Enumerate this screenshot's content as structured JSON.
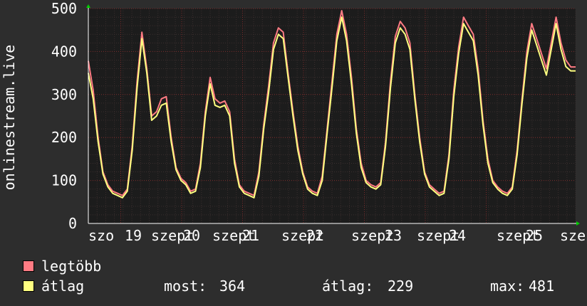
{
  "chart_data": {
    "type": "line",
    "ylabel": "onlinestream.live",
    "ylim": [
      0,
      500
    ],
    "y_ticks": [
      0,
      100,
      200,
      300,
      400,
      500
    ],
    "x_tick_labels": [
      "szo",
      "19",
      "szept",
      "20",
      "szept",
      "21",
      "szept",
      "22",
      "szept",
      "23",
      "szept",
      "24",
      "szept",
      "25",
      "szept"
    ],
    "grid": true,
    "colors": {
      "background": "#2d2d2d",
      "plot_bg": "#1c1c1c",
      "grid_minor": "#3a2e2e",
      "grid_major": "#7a2a2a",
      "axis_arrow": "#00cc00"
    },
    "x": [
      0,
      0.1,
      0.2,
      0.3,
      0.4,
      0.5,
      0.6,
      0.7,
      0.8,
      0.9,
      1.0,
      1.1,
      1.2,
      1.3,
      1.4,
      1.5,
      1.6,
      1.7,
      1.8,
      1.9,
      2.0,
      2.1,
      2.2,
      2.3,
      2.4,
      2.5,
      2.6,
      2.7,
      2.8,
      2.9,
      3.0,
      3.1,
      3.2,
      3.3,
      3.4,
      3.5,
      3.6,
      3.7,
      3.8,
      3.9,
      4.0,
      4.1,
      4.2,
      4.3,
      4.4,
      4.5,
      4.6,
      4.7,
      4.8,
      4.9,
      5.0,
      5.1,
      5.2,
      5.3,
      5.4,
      5.5,
      5.6,
      5.7,
      5.8,
      5.9,
      6.0,
      6.1,
      6.2,
      6.3,
      6.4,
      6.5,
      6.6,
      6.7,
      6.8,
      6.9,
      7.0,
      7.1,
      7.2,
      7.3,
      7.4,
      7.5,
      7.6,
      7.7,
      7.8,
      7.9,
      8.0,
      8.1,
      8.2,
      8.3,
      8.4,
      8.5,
      8.6,
      8.7,
      8.8,
      8.9,
      9.0,
      9.1,
      9.2,
      9.3,
      9.4,
      9.5,
      9.6,
      9.7,
      9.8,
      9.9,
      10.0
    ],
    "series": [
      {
        "name": "legtöbb",
        "color": "#ff7b83",
        "values": [
          378,
          310,
          200,
          120,
          90,
          75,
          70,
          65,
          80,
          180,
          330,
          445,
          360,
          250,
          260,
          290,
          295,
          200,
          130,
          105,
          95,
          75,
          80,
          140,
          260,
          340,
          290,
          280,
          285,
          260,
          150,
          90,
          75,
          70,
          65,
          120,
          230,
          320,
          420,
          455,
          445,
          350,
          260,
          180,
          120,
          85,
          75,
          70,
          110,
          220,
          330,
          440,
          495,
          440,
          340,
          220,
          140,
          100,
          90,
          85,
          95,
          190,
          330,
          435,
          470,
          455,
          420,
          300,
          200,
          120,
          90,
          80,
          70,
          75,
          160,
          310,
          410,
          480,
          460,
          440,
          360,
          240,
          150,
          100,
          85,
          75,
          70,
          85,
          170,
          290,
          400,
          465,
          430,
          395,
          360,
          420,
          480,
          420,
          380,
          364,
          364
        ]
      },
      {
        "name": "átlag",
        "color": "#ffff80",
        "values": [
          350,
          290,
          190,
          115,
          85,
          70,
          65,
          60,
          75,
          170,
          315,
          430,
          350,
          240,
          250,
          275,
          280,
          190,
          125,
          100,
          90,
          70,
          75,
          130,
          250,
          325,
          275,
          270,
          275,
          250,
          140,
          85,
          70,
          65,
          60,
          110,
          220,
          305,
          405,
          440,
          430,
          340,
          250,
          170,
          115,
          80,
          70,
          65,
          100,
          210,
          315,
          425,
          480,
          425,
          325,
          210,
          130,
          95,
          85,
          80,
          90,
          180,
          315,
          420,
          455,
          440,
          405,
          290,
          190,
          115,
          85,
          75,
          65,
          70,
          150,
          295,
          395,
          465,
          445,
          425,
          345,
          230,
          140,
          95,
          80,
          70,
          65,
          80,
          160,
          280,
          385,
          450,
          415,
          380,
          345,
          405,
          465,
          405,
          365,
          355,
          355
        ]
      }
    ]
  },
  "legend": {
    "items": [
      {
        "label": "legtöbb",
        "color": "#ff7b83"
      },
      {
        "label": "átlag",
        "color": "#ffff80"
      }
    ],
    "stats": {
      "most_label": "most:",
      "most_value": "364",
      "atlag_label": "átlag:",
      "atlag_value": "229",
      "max_label": "max:",
      "max_value": "481"
    }
  }
}
